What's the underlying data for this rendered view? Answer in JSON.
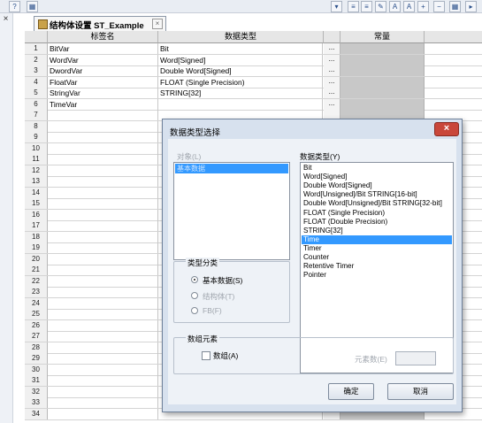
{
  "tab": {
    "title": "结构体设置 ST_Example",
    "close": "×"
  },
  "close_glyph": "×",
  "columns": {
    "name": "标签名",
    "type": "数据类型",
    "const": "常量"
  },
  "rows": [
    {
      "n": "1",
      "name": "BitVar",
      "type": "Bit"
    },
    {
      "n": "2",
      "name": "WordVar",
      "type": "Word[Signed]"
    },
    {
      "n": "3",
      "name": "DwordVar",
      "type": "Double Word[Signed]"
    },
    {
      "n": "4",
      "name": "FloatVar",
      "type": "FLOAT (Single Precision)"
    },
    {
      "n": "5",
      "name": "StringVar",
      "type": "STRING[32]"
    },
    {
      "n": "6",
      "name": "TimeVar",
      "type": ""
    },
    {
      "n": "7"
    },
    {
      "n": "8"
    },
    {
      "n": "9"
    },
    {
      "n": "10"
    },
    {
      "n": "11"
    },
    {
      "n": "12"
    },
    {
      "n": "13"
    },
    {
      "n": "14"
    },
    {
      "n": "15"
    },
    {
      "n": "16"
    },
    {
      "n": "17"
    },
    {
      "n": "18"
    },
    {
      "n": "19"
    },
    {
      "n": "20"
    },
    {
      "n": "21"
    },
    {
      "n": "22"
    },
    {
      "n": "23"
    },
    {
      "n": "24"
    },
    {
      "n": "25"
    },
    {
      "n": "26"
    },
    {
      "n": "27"
    },
    {
      "n": "28"
    },
    {
      "n": "29"
    },
    {
      "n": "30"
    },
    {
      "n": "31"
    },
    {
      "n": "32"
    },
    {
      "n": "33"
    },
    {
      "n": "34"
    }
  ],
  "ellipsis": "...",
  "dialog": {
    "title": "数据类型选择",
    "object_label": "对象(L)",
    "object_selected": "基本数据",
    "type_label": "数据类型(Y)",
    "types": [
      "Bit",
      "Word[Signed]",
      "Double Word[Signed]",
      "Word[Unsigned]/Bit STRING[16-bit]",
      "Double Word[Unsigned]/Bit STRING[32-bit]",
      "FLOAT (Single Precision)",
      "FLOAT (Double Precision)",
      "STRING[32]",
      "Time",
      "Timer",
      "Counter",
      "Retentive Timer",
      "Pointer"
    ],
    "selected_type": "Time",
    "category_label": "类型分类",
    "cat_basic": "基本数据(S)",
    "cat_struct": "结构体(T)",
    "cat_fb": "FB(F)",
    "array_label": "数组元素",
    "array_check": "数组(A)",
    "element_count": "元素数(E)",
    "ok": "确定",
    "cancel": "取消"
  },
  "colors": {
    "selection": "#3399ff",
    "const_column": "#c8c8c8",
    "close_button": "#c9473a"
  }
}
